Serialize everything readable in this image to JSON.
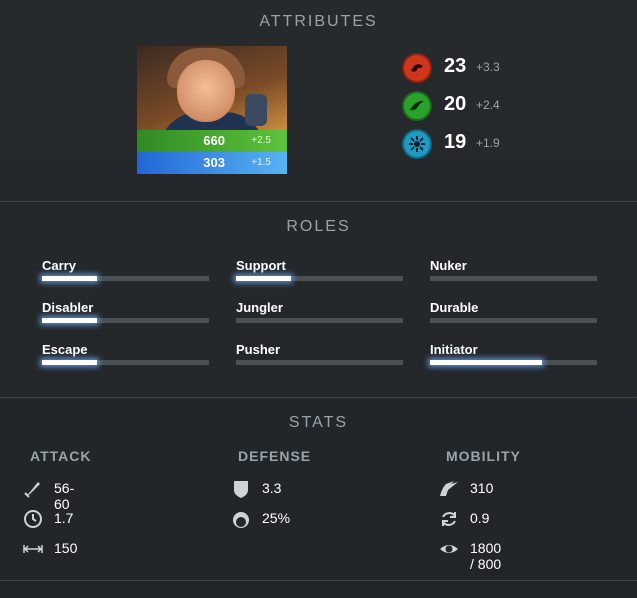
{
  "attributes": {
    "title": "ATTRIBUTES",
    "health": {
      "value": "660",
      "regen": "+2.5"
    },
    "mana": {
      "value": "303",
      "regen": "+1.5"
    },
    "strength": {
      "value": "23",
      "gain": "+3.3",
      "color": "#d0361b"
    },
    "agility": {
      "value": "20",
      "gain": "+2.4",
      "color": "#2aa12a"
    },
    "intelligence": {
      "value": "19",
      "gain": "+1.9",
      "color": "#1e9bc4"
    }
  },
  "roles": {
    "title": "ROLES",
    "items": [
      {
        "label": "Carry",
        "level": 0.33
      },
      {
        "label": "Support",
        "level": 0.33
      },
      {
        "label": "Nuker",
        "level": 0
      },
      {
        "label": "Disabler",
        "level": 0.33
      },
      {
        "label": "Jungler",
        "level": 0
      },
      {
        "label": "Durable",
        "level": 0
      },
      {
        "label": "Escape",
        "level": 0.33
      },
      {
        "label": "Pusher",
        "level": 0
      },
      {
        "label": "Initiator",
        "level": 0.67
      }
    ]
  },
  "stats": {
    "title": "STATS",
    "attack": {
      "heading": "ATTACK",
      "damage": "56-60",
      "attack_time": "1.7",
      "range": "150"
    },
    "defense": {
      "heading": "DEFENSE",
      "armor": "3.3",
      "magic_resist": "25%"
    },
    "mobility": {
      "heading": "MOBILITY",
      "move_speed": "310",
      "turn_rate": "0.9",
      "vision": "1800 / 800"
    }
  },
  "icons": [
    "strength-icon",
    "agility-icon",
    "intelligence-icon",
    "damage-icon",
    "attack-time-icon",
    "attack-range-icon",
    "armor-icon",
    "magic-resist-icon",
    "move-speed-icon",
    "turn-rate-icon",
    "vision-icon"
  ]
}
